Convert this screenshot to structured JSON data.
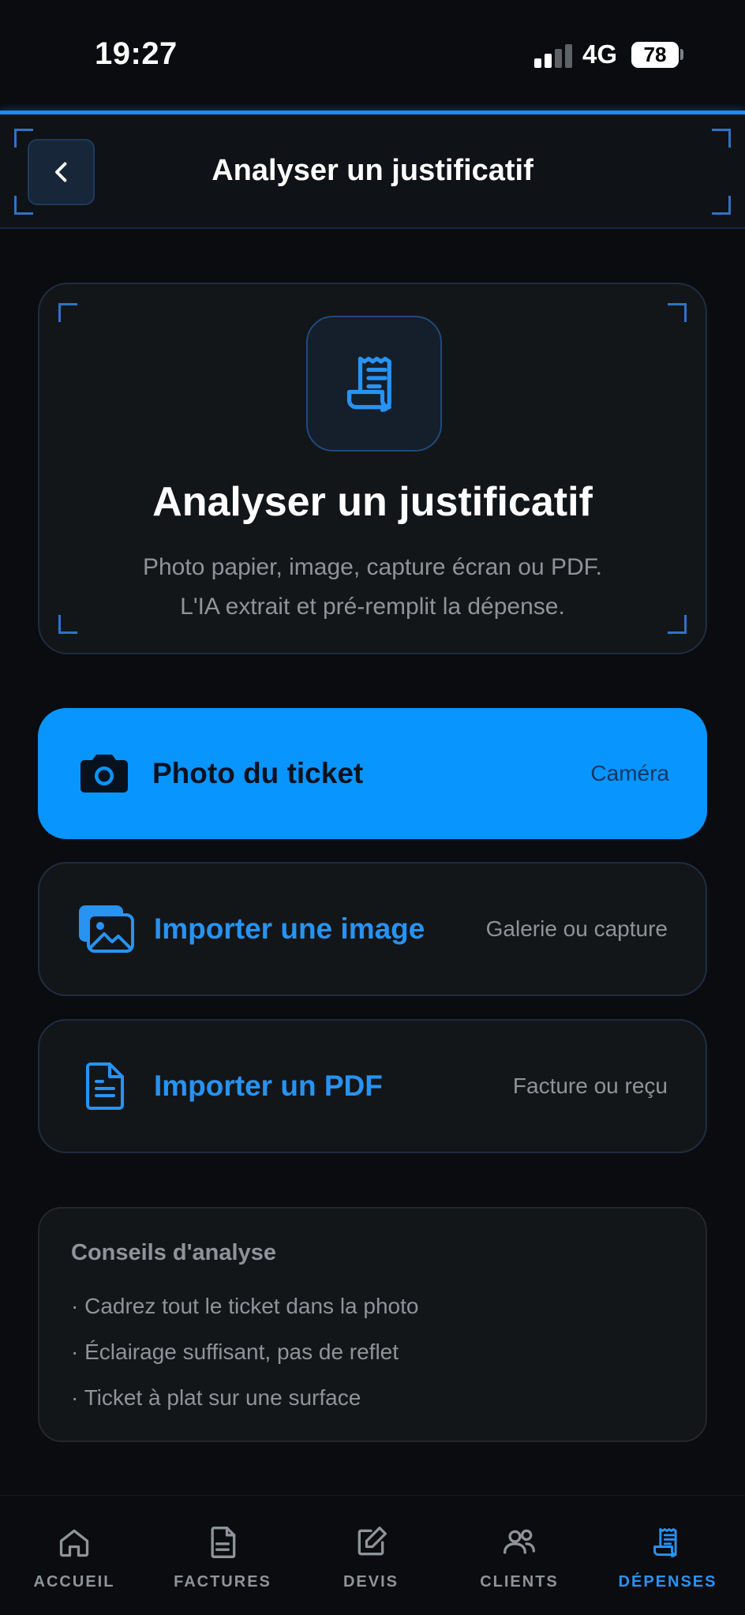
{
  "status_bar": {
    "time": "19:27",
    "network": "4G",
    "battery": "78"
  },
  "header": {
    "back_icon": "chevron-left-icon",
    "title": "Analyser un justificatif"
  },
  "hero": {
    "icon": "receipt-icon",
    "title": "Analyser un justificatif",
    "subtitle_line1": "Photo papier, image, capture écran ou PDF.",
    "subtitle_line2": "L'IA extrait et pré-remplit la dépense."
  },
  "actions": [
    {
      "icon": "camera-icon",
      "label": "Photo du ticket",
      "hint": "Caméra"
    },
    {
      "icon": "image-gallery-icon",
      "label": "Importer une image",
      "hint": "Galerie ou capture"
    },
    {
      "icon": "document-icon",
      "label": "Importer un PDF",
      "hint": "Facture ou reçu"
    }
  ],
  "tips": {
    "title": "Conseils d'analyse",
    "items": [
      "· Cadrez tout le ticket dans la photo",
      "· Éclairage suffisant, pas de reflet",
      "· Ticket à plat sur une surface"
    ]
  },
  "tabbar": {
    "items": [
      {
        "icon": "home-icon",
        "label": "ACCUEIL",
        "active": false
      },
      {
        "icon": "invoice-icon",
        "label": "FACTURES",
        "active": false
      },
      {
        "icon": "edit-icon",
        "label": "DEVIS",
        "active": false
      },
      {
        "icon": "users-icon",
        "label": "CLIENTS",
        "active": false
      },
      {
        "icon": "receipt-icon",
        "label": "DÉPENSES",
        "active": true
      }
    ]
  },
  "colors": {
    "accent": "#0895fe",
    "accent_text": "#2793f3",
    "background": "#0a0c0f",
    "card": "#131619",
    "muted_text": "#8f949b"
  }
}
